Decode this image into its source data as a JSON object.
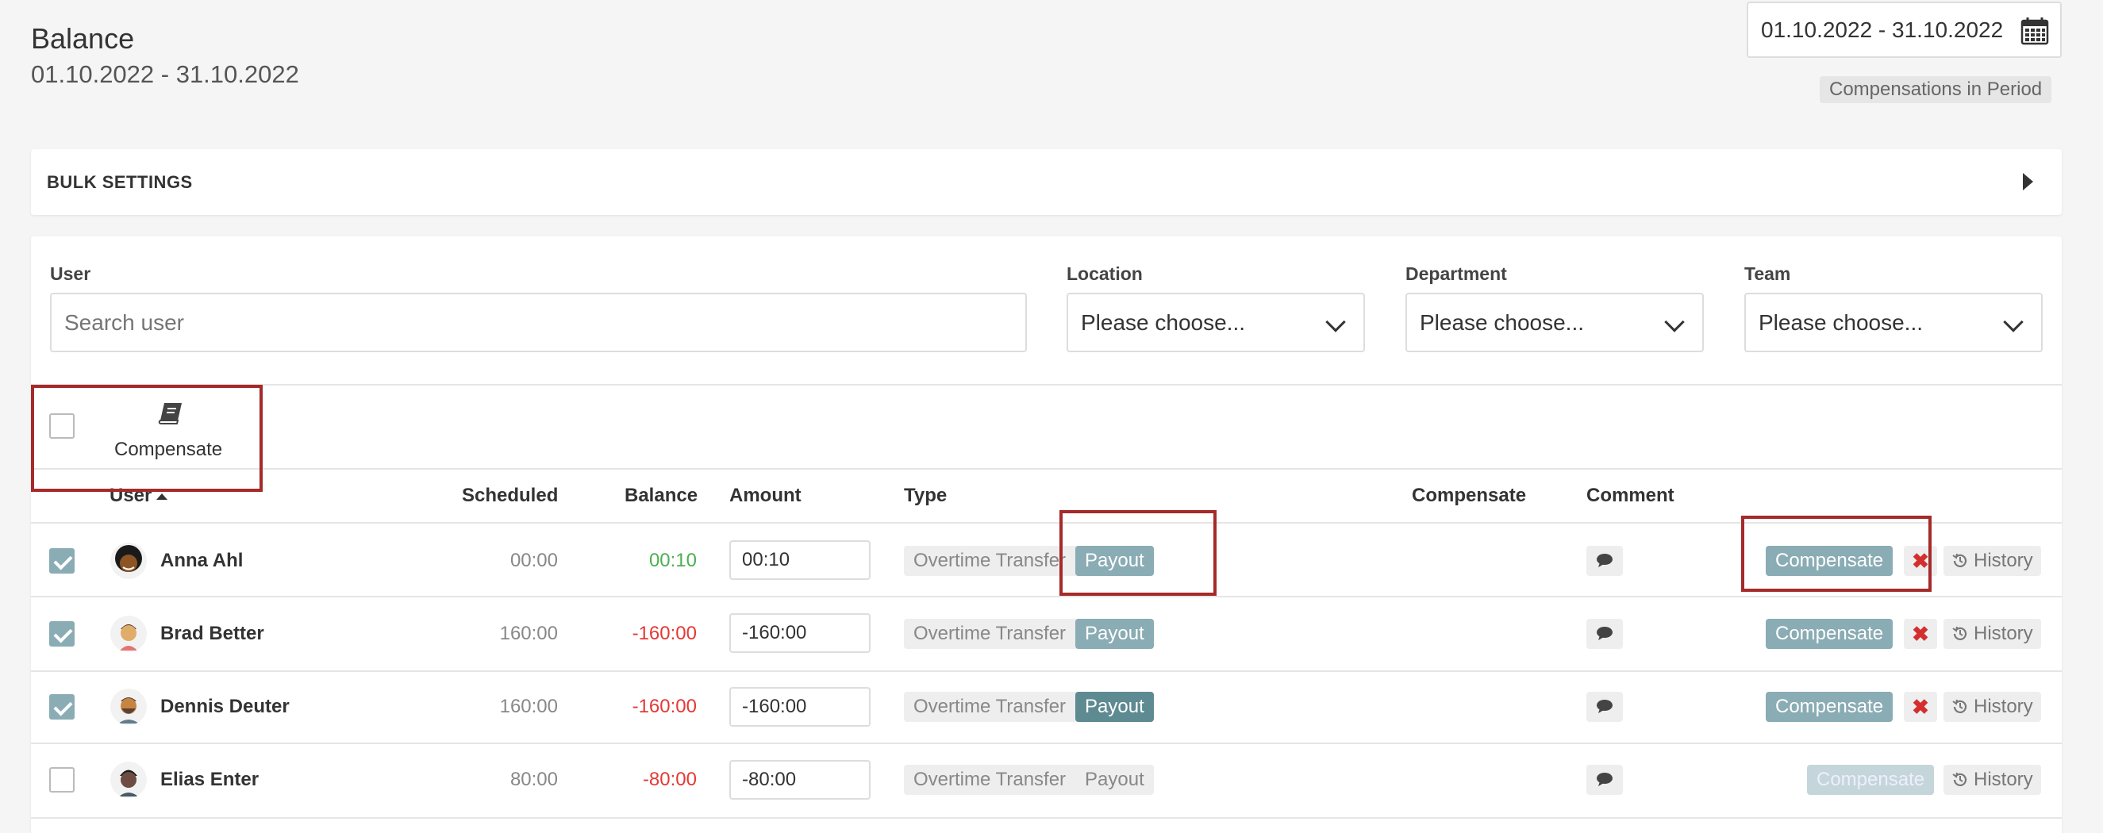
{
  "header": {
    "title": "Balance",
    "period": "01.10.2022 - 31.10.2022"
  },
  "date_picker": {
    "value": "01.10.2022 - 31.10.2022",
    "icon": "calendar-icon"
  },
  "compensations_badge": "Compensations in Period",
  "bulk_settings": {
    "label": "BULK SETTINGS"
  },
  "filters": {
    "user": {
      "label": "User",
      "placeholder": "Search user"
    },
    "location": {
      "label": "Location",
      "value": "Please choose..."
    },
    "department": {
      "label": "Department",
      "value": "Please choose..."
    },
    "team": {
      "label": "Team",
      "value": "Please choose..."
    }
  },
  "bulk_action": {
    "label": "Compensate",
    "icon": "book-icon"
  },
  "columns": {
    "user": "User",
    "scheduled": "Scheduled",
    "balance": "Balance",
    "amount": "Amount",
    "type": "Type",
    "compensate": "Compensate",
    "comment": "Comment"
  },
  "type_options": {
    "transfer": "Overtime Transfer",
    "payout": "Payout"
  },
  "actions": {
    "compensate": "Compensate",
    "remove": "✖",
    "history": "History"
  },
  "rows": [
    {
      "checked": true,
      "name": "Anna Ahl",
      "scheduled": "00:00",
      "balance": "00:10",
      "balance_sign": "positive",
      "amount": "00:10",
      "payout_selected": true,
      "compensate_enabled": true,
      "has_remove": true
    },
    {
      "checked": true,
      "name": "Brad Better",
      "scheduled": "160:00",
      "balance": "-160:00",
      "balance_sign": "negative",
      "amount": "-160:00",
      "payout_selected": true,
      "compensate_enabled": true,
      "has_remove": true
    },
    {
      "checked": true,
      "name": "Dennis Deuter",
      "scheduled": "160:00",
      "balance": "-160:00",
      "balance_sign": "negative",
      "amount": "-160:00",
      "payout_selected": true,
      "compensate_enabled": true,
      "has_remove": true
    },
    {
      "checked": false,
      "name": "Elias Enter",
      "scheduled": "80:00",
      "balance": "-80:00",
      "balance_sign": "negative",
      "amount": "-80:00",
      "payout_selected": false,
      "compensate_enabled": false,
      "has_remove": false
    }
  ],
  "colors": {
    "accent": "#8aacb4",
    "highlight": "#a52a2a",
    "positive": "#4caf50",
    "negative": "#e53935"
  }
}
